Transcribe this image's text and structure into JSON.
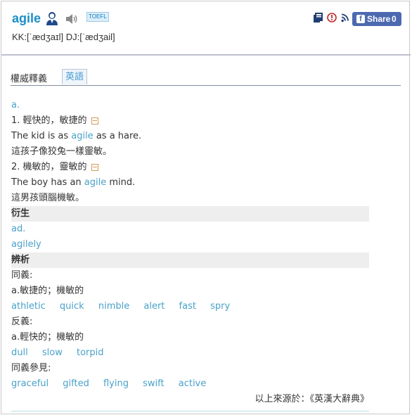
{
  "entry": {
    "word": "agile",
    "badge": "TOEFL",
    "pronunciation": "KK:[ˈædʒaɪl] DJ:[ˈædʒail]",
    "share_label": "Share",
    "share_count": "0"
  },
  "tabs": {
    "authority": "權威釋義",
    "english": "英語"
  },
  "definitions": {
    "pos": "a.",
    "sense1": "1. 輕快的，敏捷的",
    "ex1_before": "The kid is as ",
    "ex1_word": "agile",
    "ex1_after": " as a hare.",
    "ex1_zh": "這孩子像狡兔一樣靈敏。",
    "sense2": "2. 機敏的，靈敏的",
    "ex2_before": "The boy has an ",
    "ex2_word": "agile",
    "ex2_after": " mind.",
    "ex2_zh": "這男孩頭腦機敏。"
  },
  "derivatives": {
    "title": "衍生",
    "pos": "ad.",
    "word": "agilely"
  },
  "analysis": {
    "title": "辨析",
    "syn_label": "同義:",
    "syn_sense": "a.敏捷的；機敏的",
    "synonyms": [
      "athletic",
      "quick",
      "nimble",
      "alert",
      "fast",
      "spry"
    ],
    "ant_label": "反義:",
    "ant_sense": "a.輕快的；機敏的",
    "antonyms": [
      "dull",
      "slow",
      "torpid"
    ],
    "see_label": "同義參見:",
    "see_also": [
      "graceful",
      "gifted",
      "flying",
      "swift",
      "active"
    ]
  },
  "source": "以上來源於：《英漢大辭典》",
  "icons": {
    "avatar": "person-avatar-icon",
    "speaker": "speaker-icon",
    "book": "book-icon",
    "alert": "alert-icon",
    "rss": "rss-icon",
    "facebook": "facebook-icon",
    "collapse": "minus-box-icon"
  },
  "colors": {
    "accent": "#1a8fc7",
    "link": "#4aa1c9",
    "share_bg": "#4c69b0"
  }
}
